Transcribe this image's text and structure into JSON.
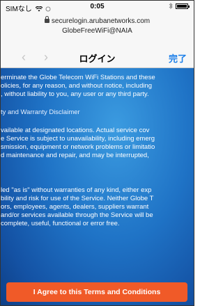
{
  "status_bar": {
    "carrier": "SIMなし",
    "time": "0:05"
  },
  "browser": {
    "url_line1": "securelogin.arubanetworks.com",
    "url_line2": "GlobeFreeWiFi@NAIA",
    "title": "ログイン",
    "done_label": "完了",
    "back_icon": "chevron-left",
    "forward_icon": "chevron-right"
  },
  "terms": {
    "lines": [
      "erminate the Globe Telecom WiFi Stations and these",
      "olicies, for any reason, and without notice, including",
      ", without liability to you, any user or any third party.",
      "ty and Warranty Disclaimer",
      "vailable at designated locations.  Actual service cov",
      "e Service is subject to unavailability, including emerg",
      "smission, equipment or network problems or limitatio",
      "d maintenance and repair, and may be interrupted,",
      "led \"as is\" without warranties of any kind, either exp",
      "bility and risk for use of the Service. Neither Globe T",
      "ors, employees, agents, dealers, suppliers warrant",
      " and/or services available through the Service will be",
      "complete, useful, functional or error free."
    ]
  },
  "agree_button_label": "I Agree to this Terms and Conditions",
  "colors": {
    "accent": "#1a7ee8",
    "button": "#f05a28",
    "background_blue": "#1f73c6"
  }
}
